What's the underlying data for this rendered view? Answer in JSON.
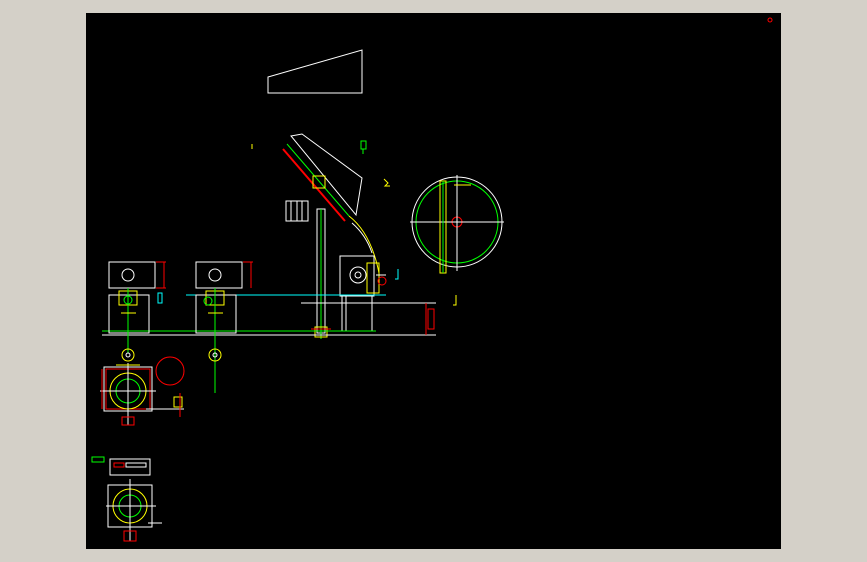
{
  "window": {
    "background": "#d4d0c8"
  },
  "canvas": {
    "background": "#000000"
  },
  "colors": {
    "white": "#ffffff",
    "green": "#00ff00",
    "yellow": "#ffff00",
    "red": "#ff0000",
    "cyan": "#00ffff",
    "magenta": "#ff00ff"
  }
}
